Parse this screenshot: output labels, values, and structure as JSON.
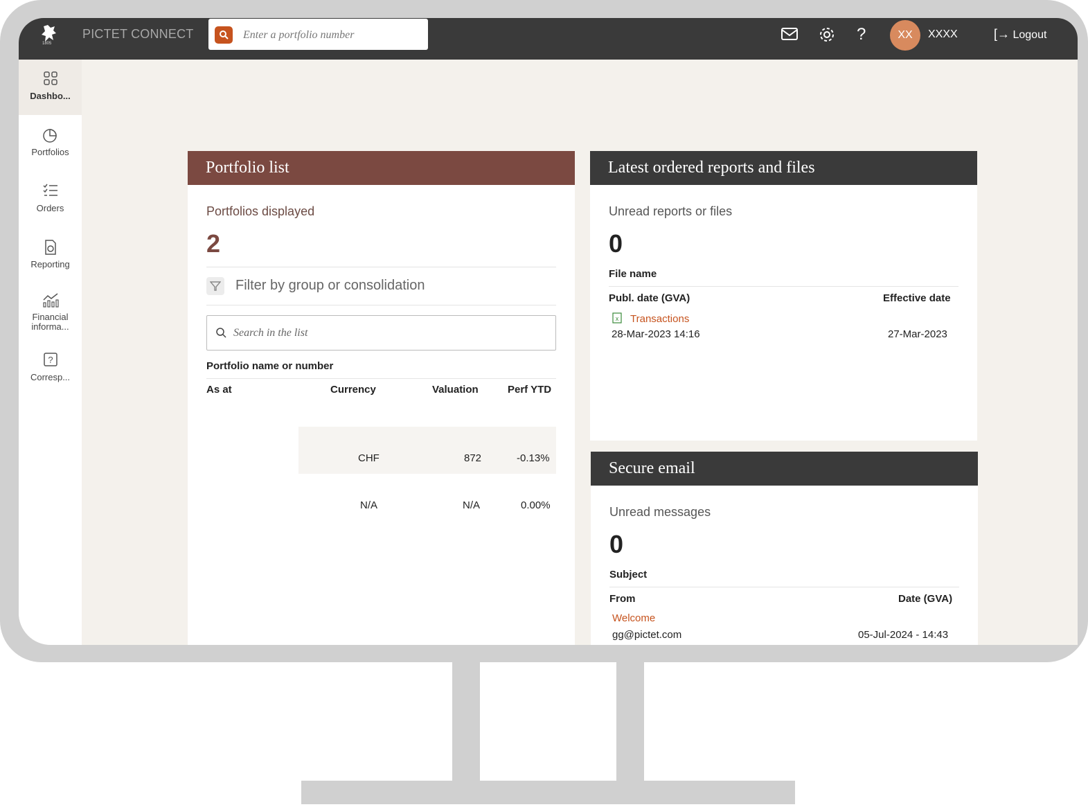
{
  "topbar": {
    "brand": "PICTET CONNECT",
    "logo_year": "1805",
    "search_placeholder": "Enter a portfolio number",
    "avatar_initials": "XX",
    "username": "XXXX",
    "logout_label": "Logout"
  },
  "sidebar": {
    "items": [
      {
        "label": "Dashbo...",
        "icon": "grid-icon"
      },
      {
        "label": "Portfolios",
        "icon": "pie-chart-icon"
      },
      {
        "label": "Orders",
        "icon": "checklist-icon"
      },
      {
        "label": "Reporting",
        "icon": "report-icon"
      },
      {
        "label": "Financial informa...",
        "icon": "chart-icon"
      },
      {
        "label": "Corresp...",
        "icon": "question-icon"
      }
    ]
  },
  "portfolio_list": {
    "title": "Portfolio list",
    "displayed_label": "Portfolios displayed",
    "displayed_count": "2",
    "filter_label": "Filter by group or consolidation",
    "search_placeholder": "Search in the list",
    "col_name": "Portfolio name or number",
    "col_as_at": "As at",
    "col_currency": "Currency",
    "col_valuation": "Valuation",
    "col_perf": "Perf YTD",
    "rows": [
      {
        "currency": "CHF",
        "valuation": "872",
        "perf": "-0.13%"
      },
      {
        "currency": "N/A",
        "valuation": "N/A",
        "perf": "0.00%"
      }
    ]
  },
  "reports": {
    "title": "Latest ordered reports and files",
    "unread_label": "Unread reports or files",
    "unread_count": "0",
    "col_file_name": "File name",
    "col_publ_date": "Publ. date (GVA)",
    "col_effective": "Effective date",
    "items": [
      {
        "name": "Transactions",
        "publ_date": "28-Mar-2023 14:16",
        "effective_date": "27-Mar-2023"
      }
    ]
  },
  "email": {
    "title": "Secure email",
    "unread_label": "Unread messages",
    "unread_count": "0",
    "col_subject": "Subject",
    "col_from": "From",
    "col_date": "Date (GVA)",
    "items": [
      {
        "subject": "Welcome",
        "from": "gg@pictet.com",
        "date": "05-Jul-2024 - 14:43"
      }
    ]
  },
  "colors": {
    "brand_brown": "#7b4941",
    "accent_orange": "#c6531e",
    "topbar_dark": "#3a3a3a"
  }
}
